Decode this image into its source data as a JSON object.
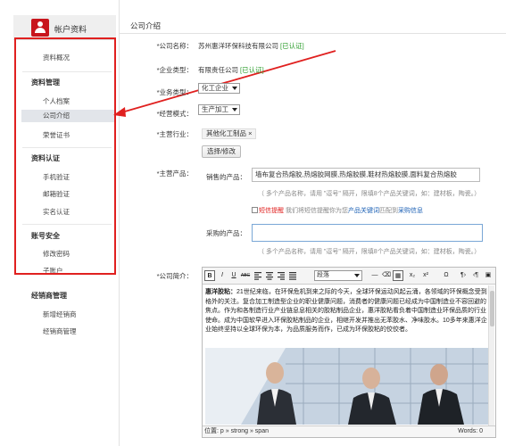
{
  "sidebar": {
    "title": "帐户资料",
    "groups": [
      {
        "label": "资料管理"
      },
      {
        "label": "资料认证"
      },
      {
        "label": "账号安全"
      },
      {
        "label": "经销商管理"
      }
    ],
    "items": [
      {
        "label": "资料概况"
      },
      {
        "label": "个人档案"
      },
      {
        "label": "公司介绍"
      },
      {
        "label": "荣誉证书"
      },
      {
        "label": "手机验证"
      },
      {
        "label": "邮箱验证"
      },
      {
        "label": "实名认证"
      },
      {
        "label": "修改密码"
      },
      {
        "label": "子账户"
      },
      {
        "label": "新增经销商"
      },
      {
        "label": "经销商管理"
      }
    ],
    "active_item": "公司介绍"
  },
  "main": {
    "title": "公司介绍",
    "company_name_label": "*公司名称：",
    "company_name": "苏州惠洋环保科技有限公司",
    "verified": "[已认证]",
    "enterprise_type_label": "*企业类型：",
    "enterprise_type": "有限责任公司",
    "business_type_label": "*业务类型：",
    "business_type": "化工企业",
    "business_mode_label": "*经营模式：",
    "business_mode": "生产加工",
    "industry_label": "*主营行业：",
    "industry_tag": "其他化工制品 ×",
    "industry_button": "选择/修改",
    "products_label": "*主营产品：",
    "sell_label": "销售的产品：",
    "sell_value": "墙布复合热熔胶,热熔胶网膜,热熔胶膜,鞋材热熔胶膜,面料复合热熔胶",
    "sell_hint": "（ 多个产品名称，请用 \"逗号\" 隔开，限填8个产品关键词，如：建材板，陶瓷。）",
    "sms_prefix": "短信提醒",
    "sms_middle": "我们将短信提醒你为您",
    "sms_link1": "产品关键词",
    "sms_mid2": "匹配到",
    "sms_link2": "采购信息",
    "buy_label": "采购的产品：",
    "buy_value": "",
    "buy_hint": "（ 多个产品名称，请用 \"逗号\" 隔开，限填8个产品关键词，如：建材板，陶瓷。）",
    "intro_label": "*公司简介：",
    "editor": {
      "style_select": "段落",
      "content_bold": "惠洋胶粘：",
      "content": "21世纪来临，在环保危机到来之际的今天，全球环保运动风起云涌，各领域的环保概念受到格外的关注。复合加工制造型企业的职业健康问题，消费者的健康问题已经成为中国制造业不容回避的焦点。作为和各制造行业产业链息息相关的胶粘制品企业，惠洋胶粘看负着中国制造业环保品质的行业使命。成为中国软早进入环保胶粘制品的企业，相继开发并推出无苯胶水、净味胶水。10多年来惠洋企业始终坚持以全球环保为本，为品质服务而作，已成为环保胶粘的佼佼者。",
      "status_path": "位置: p » strong » span",
      "status_words": "Words: 0"
    }
  },
  "colors": {
    "accent_red": "#e0201f",
    "verified_green": "#2a9c2a",
    "link_blue": "#1a5fb4"
  }
}
